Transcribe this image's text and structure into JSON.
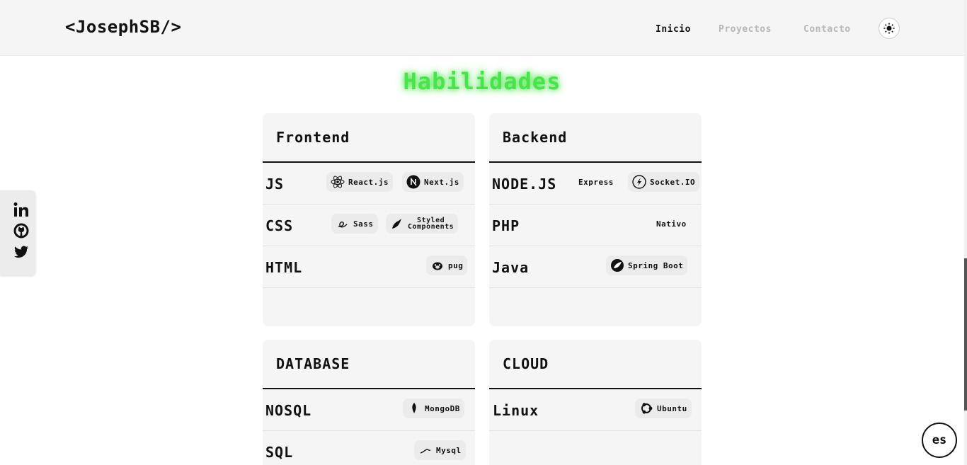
{
  "header": {
    "logo": "<JosephSB/>",
    "nav": [
      "Inicio",
      "Proyectos",
      "Contacto"
    ],
    "theme_icon": "sun-icon"
  },
  "social": [
    "linkedin-icon",
    "github-icon",
    "twitter-icon"
  ],
  "section_title": "Habilidades",
  "cards": [
    {
      "title": "Frontend",
      "rows": [
        {
          "name": "JS",
          "chips": [
            {
              "label": "React.js",
              "icon": "react-icon"
            },
            {
              "label": "Next.js",
              "icon": "nextjs-icon"
            }
          ]
        },
        {
          "name": "CSS",
          "chips": [
            {
              "label": "Sass",
              "icon": "sass-icon"
            },
            {
              "label": "Styled Components",
              "line1": "Styled",
              "line2": "Components",
              "icon": "styled-components-icon"
            }
          ]
        },
        {
          "name": "HTML",
          "chips": [
            {
              "label": "pug",
              "icon": "pug-icon"
            }
          ]
        }
      ]
    },
    {
      "title": "Backend",
      "rows": [
        {
          "name": "NODE.JS",
          "chips": [
            {
              "label": "Express",
              "icon": ""
            },
            {
              "label": "Socket.IO",
              "icon": "socketio-icon"
            }
          ]
        },
        {
          "name": "PHP",
          "chips": [
            {
              "label": "Nativo",
              "icon": ""
            }
          ]
        },
        {
          "name": "Java",
          "chips": [
            {
              "label": "Spring Boot",
              "icon": "spring-icon"
            }
          ]
        }
      ]
    },
    {
      "title": "DATABASE",
      "rows": [
        {
          "name": "NOSQL",
          "chips": [
            {
              "label": "MongoDB",
              "icon": "mongodb-icon"
            }
          ]
        },
        {
          "name": "SQL",
          "chips": [
            {
              "label": "Mysql",
              "icon": "mysql-icon"
            }
          ]
        }
      ]
    },
    {
      "title": "CLOUD",
      "rows": [
        {
          "name": "Linux",
          "chips": [
            {
              "label": "Ubuntu",
              "icon": "ubuntu-icon"
            }
          ]
        }
      ]
    }
  ],
  "lang_button": "es",
  "colors": {
    "accent": "#4be34b",
    "card_bg": "#f5f5f5",
    "header_bg": "#f5f5f5"
  }
}
